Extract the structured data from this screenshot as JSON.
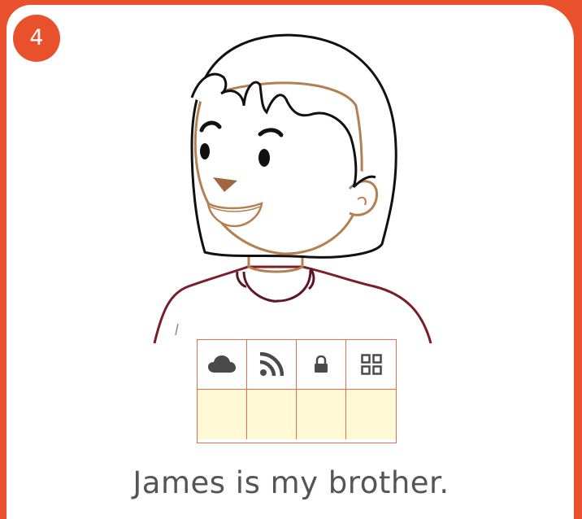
{
  "page": {
    "number": "4",
    "caption": "James is my brother.",
    "background_color": "#e9502c",
    "card_color": "#ffffff"
  },
  "puzzle": {
    "icons": [
      "cloud-icon",
      "rss-feed-icon",
      "lock-icon",
      "grid-icon"
    ],
    "answer_cells": [
      "",
      "",
      "",
      ""
    ],
    "answer_cell_color": "#fff9d5",
    "grid_line_color": "#e46f52"
  }
}
